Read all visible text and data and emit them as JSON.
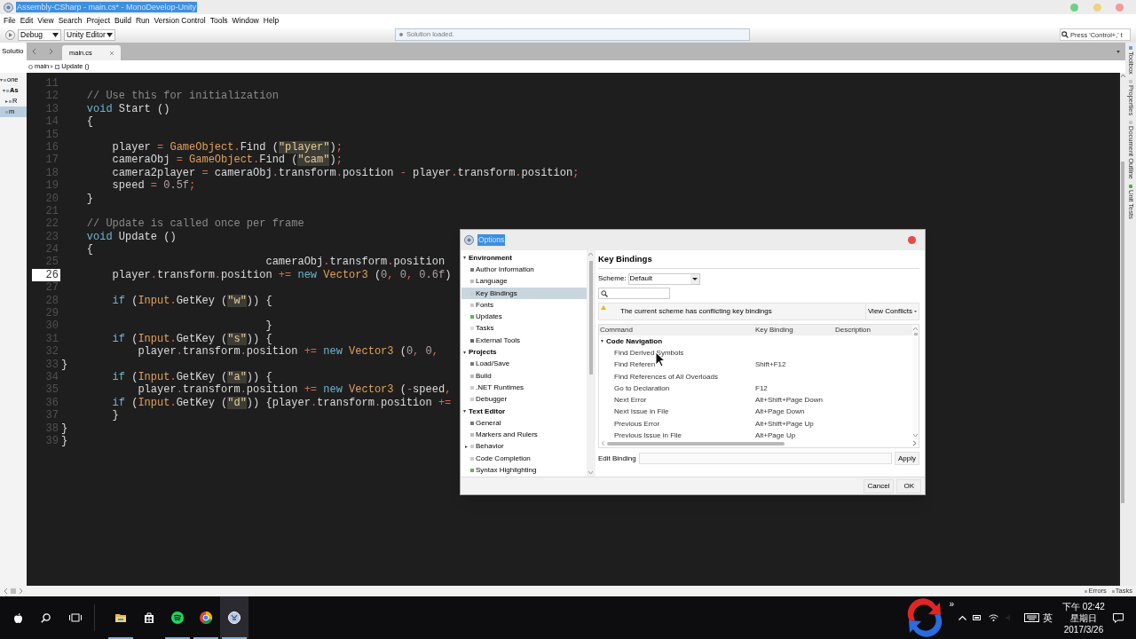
{
  "window": {
    "title": "Assembly-CSharp - main.cs* - MonoDevelop-Unity"
  },
  "menu": [
    "File",
    "Edit",
    "View",
    "Search",
    "Project",
    "Build",
    "Run",
    "Version Control",
    "Tools",
    "Window",
    "Help"
  ],
  "toolbar": {
    "configuration": "Debug",
    "target": "Unity Editor",
    "status": "Solution loaded.",
    "search_placeholder": "Press 'Control+,' t"
  },
  "solution_pad": {
    "title": "Solutio",
    "items": [
      {
        "label": "one",
        "expanded": true,
        "selected": false,
        "children": [
          {
            "label": "As",
            "expanded": true,
            "selected": false,
            "children": [
              {
                "label": "R",
                "expanded": false,
                "selected": false
              },
              {
                "label": "m",
                "selected": true
              }
            ]
          }
        ]
      }
    ]
  },
  "tabs": [
    {
      "label": "main.cs",
      "selected": true
    }
  ],
  "breadcrumb": [
    "main",
    "Update ()"
  ],
  "editor": {
    "lines": [
      {
        "n": "11",
        "current": false
      },
      {
        "n": "12",
        "current": false,
        "tokens": [
          {
            "text": "    // Use this for initialization",
            "kind": "comment"
          }
        ]
      },
      {
        "n": "13",
        "current": false,
        "tokens": [
          {
            "text": "    void",
            "kind": "keyword"
          },
          {
            "text": " Start ()",
            "kind": "plain"
          }
        ]
      },
      {
        "n": "14",
        "current": false,
        "tokens": [
          {
            "text": "    {",
            "kind": "plain"
          }
        ]
      },
      {
        "n": "15",
        "current": false
      },
      {
        "n": "16",
        "current": false,
        "tokens": [
          {
            "text": "        player ",
            "kind": "plain"
          },
          {
            "text": "= ",
            "kind": "operator"
          },
          {
            "text": "GameObject",
            "kind": "type"
          },
          {
            "text": ".",
            "kind": "operator"
          },
          {
            "text": "Find (",
            "kind": "plain"
          },
          {
            "text": "\"player\"",
            "kind": "string"
          },
          {
            "text": ")",
            "kind": "plain"
          },
          {
            "text": ";",
            "kind": "operator"
          }
        ]
      },
      {
        "n": "17",
        "current": false,
        "tokens": [
          {
            "text": "        cameraObj ",
            "kind": "plain"
          },
          {
            "text": "= ",
            "kind": "operator"
          },
          {
            "text": "GameObject",
            "kind": "type"
          },
          {
            "text": ".",
            "kind": "operator"
          },
          {
            "text": "Find (",
            "kind": "plain"
          },
          {
            "text": "\"cam\"",
            "kind": "string"
          },
          {
            "text": ")",
            "kind": "plain"
          },
          {
            "text": ";",
            "kind": "operator"
          }
        ]
      },
      {
        "n": "18",
        "current": false,
        "tokens": [
          {
            "text": "        camera2player ",
            "kind": "plain"
          },
          {
            "text": "=",
            "kind": "operator"
          },
          {
            "text": " cameraObj",
            "kind": "plain"
          },
          {
            "text": ".",
            "kind": "operator"
          },
          {
            "text": "transform",
            "kind": "plain"
          },
          {
            "text": ".",
            "kind": "operator"
          },
          {
            "text": "position ",
            "kind": "plain"
          },
          {
            "text": "-",
            "kind": "operator"
          },
          {
            "text": " player",
            "kind": "plain"
          },
          {
            "text": ".",
            "kind": "operator"
          },
          {
            "text": "transform",
            "kind": "plain"
          },
          {
            "text": ".",
            "kind": "operator"
          },
          {
            "text": "position",
            "kind": "plain"
          },
          {
            "text": ";",
            "kind": "operator"
          }
        ]
      },
      {
        "n": "19",
        "current": false,
        "tokens": [
          {
            "text": "        speed ",
            "kind": "plain"
          },
          {
            "text": "= ",
            "kind": "operator"
          },
          {
            "text": "0.5f",
            "kind": "number"
          },
          {
            "text": ";",
            "kind": "operator"
          }
        ]
      },
      {
        "n": "20",
        "current": false,
        "tokens": [
          {
            "text": "    }",
            "kind": "plain"
          }
        ]
      },
      {
        "n": "21",
        "current": false
      },
      {
        "n": "22",
        "current": false,
        "tokens": [
          {
            "text": "    // Update is called once per frame",
            "kind": "comment"
          }
        ]
      },
      {
        "n": "23",
        "current": false,
        "tokens": [
          {
            "text": "    void",
            "kind": "keyword"
          },
          {
            "text": " Update ()",
            "kind": "plain"
          }
        ]
      },
      {
        "n": "24",
        "current": false,
        "tokens": [
          {
            "text": "    {",
            "kind": "plain"
          }
        ]
      },
      {
        "n": "25",
        "current": false,
        "tokens": [
          {
            "text": "                                cameraObj",
            "kind": "plain"
          },
          {
            "text": ".",
            "kind": "operator"
          },
          {
            "text": "transform",
            "kind": "plain"
          },
          {
            "text": ".",
            "kind": "operator"
          },
          {
            "text": "position",
            "kind": "plain"
          }
        ]
      },
      {
        "n": "26",
        "current": true,
        "tokens": [
          {
            "text": "        player",
            "kind": "plain"
          },
          {
            "text": ".",
            "kind": "operator"
          },
          {
            "text": "transform",
            "kind": "plain"
          },
          {
            "text": ".",
            "kind": "operator"
          },
          {
            "text": "position ",
            "kind": "plain"
          },
          {
            "text": "+= ",
            "kind": "operator"
          },
          {
            "text": "new ",
            "kind": "keyword"
          },
          {
            "text": "Vector3",
            "kind": "type"
          },
          {
            "text": " (",
            "kind": "plain"
          },
          {
            "text": "0",
            "kind": "number"
          },
          {
            "text": ", ",
            "kind": "operator"
          },
          {
            "text": "0",
            "kind": "number"
          },
          {
            "text": ", ",
            "kind": "operator"
          },
          {
            "text": "0.6f",
            "kind": "number"
          },
          {
            "text": ")",
            "kind": "plain"
          }
        ]
      },
      {
        "n": "27",
        "current": false
      },
      {
        "n": "28",
        "current": false,
        "tokens": [
          {
            "text": "        if",
            "kind": "keyword"
          },
          {
            "text": " (",
            "kind": "plain"
          },
          {
            "text": "Input",
            "kind": "type"
          },
          {
            "text": ".",
            "kind": "operator"
          },
          {
            "text": "GetKey (",
            "kind": "plain"
          },
          {
            "text": "\"w\"",
            "kind": "string"
          },
          {
            "text": ")) {",
            "kind": "plain"
          }
        ]
      },
      {
        "n": "29",
        "current": false
      },
      {
        "n": "30",
        "current": false,
        "tokens": [
          {
            "text": "                                }",
            "kind": "plain"
          }
        ]
      },
      {
        "n": "31",
        "current": false,
        "tokens": [
          {
            "text": "        if",
            "kind": "keyword"
          },
          {
            "text": " (",
            "kind": "plain"
          },
          {
            "text": "Input",
            "kind": "type"
          },
          {
            "text": ".",
            "kind": "operator"
          },
          {
            "text": "GetKey (",
            "kind": "plain"
          },
          {
            "text": "\"s\"",
            "kind": "string"
          },
          {
            "text": ")) {",
            "kind": "plain"
          }
        ]
      },
      {
        "n": "32",
        "current": false,
        "tokens": [
          {
            "text": "            player",
            "kind": "plain"
          },
          {
            "text": ".",
            "kind": "operator"
          },
          {
            "text": "transform",
            "kind": "plain"
          },
          {
            "text": ".",
            "kind": "operator"
          },
          {
            "text": "position ",
            "kind": "plain"
          },
          {
            "text": "+= ",
            "kind": "operator"
          },
          {
            "text": "new ",
            "kind": "keyword"
          },
          {
            "text": "Vector3",
            "kind": "type"
          },
          {
            "text": " (",
            "kind": "plain"
          },
          {
            "text": "0",
            "kind": "number"
          },
          {
            "text": ", ",
            "kind": "operator"
          },
          {
            "text": "0",
            "kind": "number"
          },
          {
            "text": ",",
            "kind": "operator"
          }
        ]
      },
      {
        "n": "33",
        "current": false,
        "tokens": [
          {
            "text": "}",
            "kind": "plain"
          }
        ]
      },
      {
        "n": "34",
        "current": false,
        "tokens": [
          {
            "text": "        if",
            "kind": "keyword"
          },
          {
            "text": " (",
            "kind": "plain"
          },
          {
            "text": "Input",
            "kind": "type"
          },
          {
            "text": ".",
            "kind": "operator"
          },
          {
            "text": "GetKey (",
            "kind": "plain"
          },
          {
            "text": "\"a\"",
            "kind": "string"
          },
          {
            "text": ")) {",
            "kind": "plain"
          }
        ]
      },
      {
        "n": "35",
        "current": false,
        "tokens": [
          {
            "text": "            player",
            "kind": "plain"
          },
          {
            "text": ".",
            "kind": "operator"
          },
          {
            "text": "transform",
            "kind": "plain"
          },
          {
            "text": ".",
            "kind": "operator"
          },
          {
            "text": "position ",
            "kind": "plain"
          },
          {
            "text": "+= ",
            "kind": "operator"
          },
          {
            "text": "new ",
            "kind": "keyword"
          },
          {
            "text": "Vector3",
            "kind": "type"
          },
          {
            "text": " (",
            "kind": "plain"
          },
          {
            "text": "-",
            "kind": "operator"
          },
          {
            "text": "speed",
            "kind": "plain"
          },
          {
            "text": ",",
            "kind": "operator"
          }
        ]
      },
      {
        "n": "36",
        "current": false,
        "tokens": [
          {
            "text": "        if",
            "kind": "keyword"
          },
          {
            "text": " (",
            "kind": "plain"
          },
          {
            "text": "Input",
            "kind": "type"
          },
          {
            "text": ".",
            "kind": "operator"
          },
          {
            "text": "GetKey (",
            "kind": "plain"
          },
          {
            "text": "\"d\"",
            "kind": "string"
          },
          {
            "text": ")) {player",
            "kind": "plain"
          },
          {
            "text": ".",
            "kind": "operator"
          },
          {
            "text": "transform",
            "kind": "plain"
          },
          {
            "text": ".",
            "kind": "operator"
          },
          {
            "text": "position ",
            "kind": "plain"
          },
          {
            "text": "+=",
            "kind": "operator"
          }
        ]
      },
      {
        "n": "37",
        "current": false,
        "tokens": [
          {
            "text": "        }",
            "kind": "plain"
          }
        ]
      },
      {
        "n": "38",
        "current": false,
        "tokens": [
          {
            "text": "}",
            "kind": "plain"
          }
        ]
      },
      {
        "n": "39",
        "current": false,
        "tokens": [
          {
            "text": "}",
            "kind": "plain"
          }
        ]
      }
    ]
  },
  "side_pads": [
    "Toolbox",
    "Properties",
    "Document Outline",
    "Unit Tests"
  ],
  "bottom_pads": [
    "Errors",
    "Tasks"
  ],
  "dialog": {
    "title": "Options",
    "tree": [
      {
        "label": "Environment",
        "expanded": true,
        "children": [
          {
            "label": "Author Information",
            "selected": false
          },
          {
            "label": "Language",
            "selected": false
          },
          {
            "label": "Key Bindings",
            "selected": true
          },
          {
            "label": "Fonts",
            "selected": false
          },
          {
            "label": "Updates",
            "selected": false
          },
          {
            "label": "Tasks",
            "selected": false
          },
          {
            "label": "External Tools",
            "selected": false
          }
        ]
      },
      {
        "label": "Projects",
        "expanded": true,
        "children": [
          {
            "label": "Load/Save",
            "selected": false
          },
          {
            "label": "Build",
            "selected": false
          },
          {
            "label": ".NET Runtimes",
            "selected": false
          },
          {
            "label": "Debugger",
            "selected": false
          }
        ]
      },
      {
        "label": "Text Editor",
        "expanded": true,
        "children": [
          {
            "label": "General",
            "selected": false
          },
          {
            "label": "Markers and Rulers",
            "selected": false
          },
          {
            "label": "Behavior",
            "selected": false,
            "expanded": false
          },
          {
            "label": "Code Completion",
            "selected": false
          },
          {
            "label": "Syntax Highlighting",
            "selected": false
          }
        ]
      }
    ],
    "heading": "Key Bindings",
    "scheme_label": "Scheme:",
    "scheme": "Default",
    "warning": "The current scheme has conflicting key bindings",
    "conflicts_button": "View Conflicts",
    "columns": [
      "Command",
      "Key Binding",
      "Description"
    ],
    "groups": [
      {
        "name": "Code Navigation",
        "expanded": true,
        "rows": [
          {
            "command": "Find Derived Symbols"
          },
          {
            "command": "Find Referen",
            "binding": "Shift+F12"
          },
          {
            "command": "Find References of All Overloads"
          },
          {
            "command": "Go to Declaration",
            "binding": "F12"
          },
          {
            "command": "Next Error",
            "binding": "Alt+Shift+Page Down"
          },
          {
            "command": "Next Issue in File",
            "binding": "Alt+Page Down"
          },
          {
            "command": "Previous Error",
            "binding": "Alt+Shift+Page Up"
          },
          {
            "command": "Previous Issue in File",
            "binding": "Alt+Page Up"
          }
        ]
      }
    ],
    "edit_label": "Edit Binding",
    "apply": "Apply",
    "cancel": "Cancel",
    "ok": "OK"
  },
  "taskbar": {
    "apps": [
      {
        "kind": "folder",
        "running": true,
        "selected": false
      },
      {
        "kind": "store",
        "running": false,
        "selected": false
      },
      {
        "kind": "music",
        "running": true,
        "selected": false
      },
      {
        "kind": "browser",
        "running": true,
        "selected": false
      },
      {
        "kind": "ide",
        "running": true,
        "selected": true
      }
    ],
    "overflow": "»",
    "ime": "英",
    "time": "下午 02:42",
    "day": "星期日",
    "date": "2017/3/26"
  }
}
